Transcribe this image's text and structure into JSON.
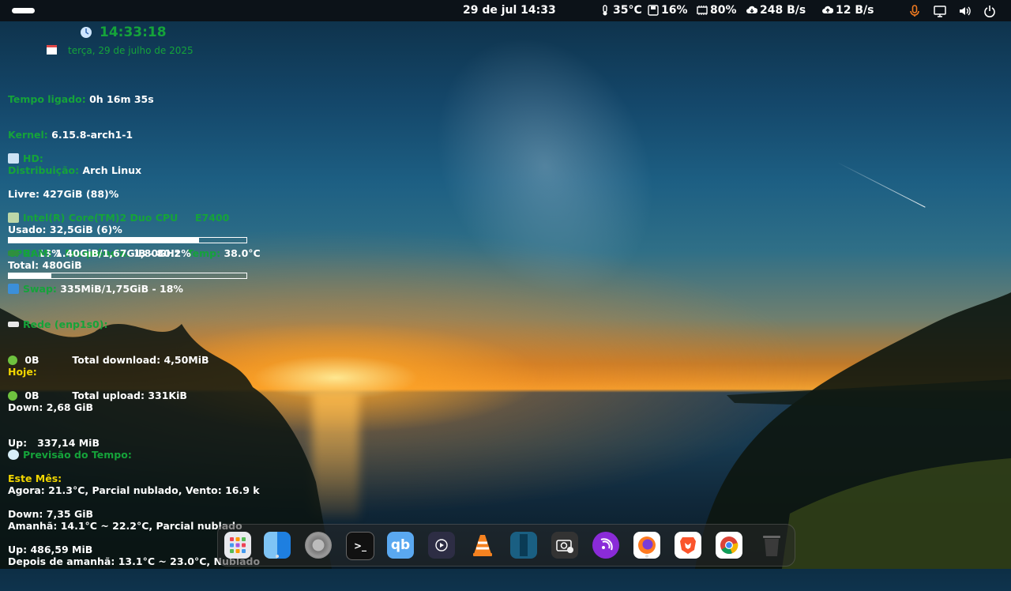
{
  "topbar": {
    "datetime": "29 de jul  14:33",
    "temp": "35°C",
    "disk": "16%",
    "mem": "80%",
    "download": "248 B/s",
    "upload": "12 B/s"
  },
  "conky": {
    "time": "14:33:18",
    "date": "terça, 29 de julho de 2025",
    "uptime_label": "Tempo ligado:",
    "uptime": "0h 16m 35s",
    "kernel_label": "Kernel:",
    "kernel": "6.15.8-arch1-1",
    "distro_label": "Distribuição:",
    "distro": "Arch Linux",
    "hd_label": "HD:",
    "hd_free": "Livre: 427GiB (88)%",
    "hd_used": "Usado: 32,5GiB (6)%",
    "hd_total": "Total: 480GiB",
    "cpu_name": "Intel(R) Core(TM)2 Duo CPU     E7400",
    "cpu_label": "CPU:",
    "cpu_value": "13%",
    "freq_label": "Frequência:",
    "freq_value": "1,80GHz",
    "temp_label": "Temp:",
    "temp_value": "38.0°C",
    "ram_label": "RAM:",
    "ram_value": "1.40GiB/1,67GiB - 80.2%",
    "ram_fraction": 0.802,
    "swap_label": "Swap:",
    "swap_value": "335MiB/1,75GiB - 18%",
    "swap_fraction": 0.18,
    "net_label": "Rede (enp1s0):",
    "down_rate": "0B",
    "total_down": "Total download: 4,50MiB",
    "up_rate": "0B",
    "total_up": "Total upload: 331KiB",
    "today_label": "Hoje:",
    "today_down": "Down: 2,68 GiB",
    "today_up": "Up:   337,14 MiB",
    "month_label": "Este Mês:",
    "month_down": "Down: 7,35 GiB",
    "month_up": "Up: 486,59 MiB",
    "weather_label": "Previsão do Tempo:",
    "weather_now": "Agora: 21.3°C, Parcial nublado, Vento: 16.9 k",
    "weather_tomorrow": "Amanhã: 14.1°C ~ 22.2°C, Parcial nublado",
    "weather_after": "Depois de amanhã: 13.1°C ~ 23.0°C, Nublado"
  },
  "dock": {
    "apps": [
      {
        "name": "app-grid-icon",
        "label": ""
      },
      {
        "name": "finder-icon",
        "label": ""
      },
      {
        "name": "settings-icon",
        "label": ""
      },
      {
        "name": "terminal-icon",
        "label": ">_"
      },
      {
        "name": "qbittorrent-icon",
        "label": "qb"
      },
      {
        "name": "video-player-icon",
        "label": ""
      },
      {
        "name": "vlc-icon",
        "label": ""
      },
      {
        "name": "book-reader-icon",
        "label": ""
      },
      {
        "name": "screenshot-icon",
        "label": ""
      },
      {
        "name": "podcast-icon",
        "label": ""
      },
      {
        "name": "firefox-icon",
        "label": ""
      },
      {
        "name": "brave-icon",
        "label": ""
      },
      {
        "name": "chrome-icon",
        "label": ""
      },
      {
        "name": "trash-icon",
        "label": ""
      }
    ]
  }
}
